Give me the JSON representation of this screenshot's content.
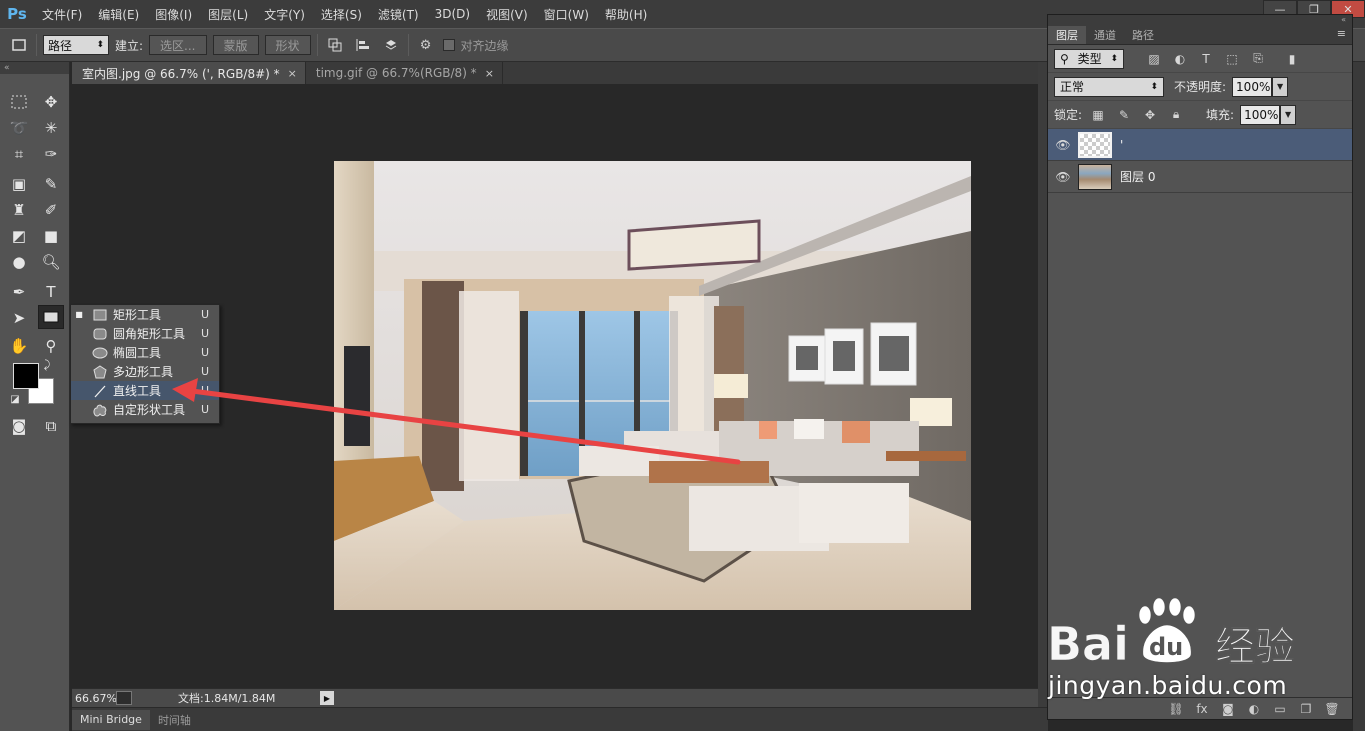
{
  "app": {
    "logo": "Ps",
    "menu": [
      "文件(F)",
      "编辑(E)",
      "图像(I)",
      "图层(L)",
      "文字(Y)",
      "选择(S)",
      "滤镜(T)",
      "3D(D)",
      "视图(V)",
      "窗口(W)",
      "帮助(H)"
    ],
    "window_controls": {
      "minimize": "—",
      "restore": "❐",
      "close": "✕"
    }
  },
  "options_bar": {
    "mode_select": "路径",
    "make_label": "建立:",
    "selection_button": "选区...",
    "mask_button": "蒙版",
    "shape_button": "形状",
    "align_edges_label": "对齐边缘"
  },
  "tabs": [
    {
      "label": "室内图.jpg @ 66.7% (', RGB/8#) *",
      "close": "×"
    },
    {
      "label": "timg.gif @ 66.7%(RGB/8) *",
      "close": "×"
    }
  ],
  "status": {
    "zoom": "66.67%",
    "doc_info": "文档:1.84M/1.84M"
  },
  "bottom_tabs": [
    "Mini Bridge",
    "时间轴"
  ],
  "flyout": {
    "items": [
      {
        "label": "矩形工具",
        "shortcut": "U",
        "icon": "rectangle-icon",
        "current": true
      },
      {
        "label": "圆角矩形工具",
        "shortcut": "U",
        "icon": "rounded-rectangle-icon",
        "current": false
      },
      {
        "label": "椭圆工具",
        "shortcut": "U",
        "icon": "ellipse-icon",
        "current": false
      },
      {
        "label": "多边形工具",
        "shortcut": "U",
        "icon": "polygon-icon",
        "current": false
      },
      {
        "label": "直线工具",
        "shortcut": "U",
        "icon": "line-icon",
        "current": false
      },
      {
        "label": "自定形状工具",
        "shortcut": "U",
        "icon": "custom-shape-icon",
        "current": false
      }
    ]
  },
  "layers_panel": {
    "tabs": [
      "图层",
      "通道",
      "路径"
    ],
    "filter_select": "类型",
    "blend_mode": "正常",
    "opacity_label": "不透明度:",
    "opacity_value": "100%",
    "lock_label": "锁定:",
    "fill_label": "填充:",
    "fill_value": "100%",
    "layers": [
      {
        "name": "'",
        "thumb": "transparent",
        "selected": true
      },
      {
        "name": "图层 0",
        "thumb": "photo",
        "selected": false
      }
    ]
  },
  "watermark": {
    "brand": "Baidu 经验",
    "url": "jingyan.baidu.com"
  },
  "colors": {
    "accent_arrow": "#e84343",
    "selection": "#46566c",
    "layer_selected": "#4b5c78",
    "ps_blue": "#5fb6ef"
  }
}
